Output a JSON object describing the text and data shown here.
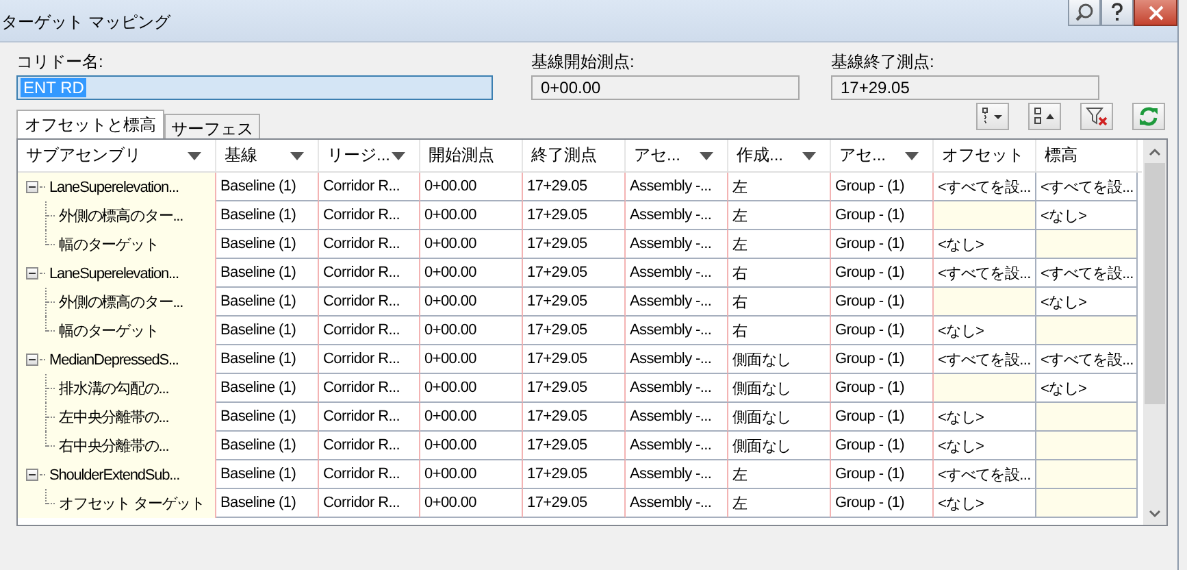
{
  "window": {
    "title": "ターゲット マッピング"
  },
  "fields": [
    {
      "label": "コリドー名:",
      "value": "ENT RD",
      "editable": true,
      "selected_text": true
    },
    {
      "label": "基線開始測点:",
      "value": "0+00.00",
      "editable": false,
      "selected_text": false
    },
    {
      "label": "基線終了測点:",
      "value": "17+29.05",
      "editable": false,
      "selected_text": false
    }
  ],
  "tabs": [
    {
      "label": "オフセットと標高",
      "selected": true
    },
    {
      "label": "サーフェス",
      "selected": false
    }
  ],
  "table": {
    "columns": [
      {
        "label": "サブアセンブリ",
        "menu": true
      },
      {
        "label": "基線",
        "menu": true
      },
      {
        "label": "リージ...",
        "menu": true
      },
      {
        "label": "開始測点",
        "menu": false
      },
      {
        "label": "終了測点",
        "menu": false
      },
      {
        "label": "アセ...",
        "menu": true
      },
      {
        "label": "作成...",
        "menu": true
      },
      {
        "label": "アセ...",
        "menu": true
      },
      {
        "label": "オフセット",
        "menu": false
      },
      {
        "label": "標高",
        "menu": false
      }
    ],
    "rows": [
      {
        "name": "LaneSuperelevation...",
        "baseline": "Baseline (1)",
        "region": "Corridor R...",
        "start": "0+00.00",
        "end": "17+29.05",
        "assembly": "Assembly -...",
        "side": "左",
        "group": "Group - (1)",
        "offset": "<すべてを設...",
        "elevation": "<すべてを設...",
        "expanded": true,
        "children": [
          {
            "name": "外側の標高のター...",
            "baseline": "Baseline (1)",
            "region": "Corridor R...",
            "start": "0+00.00",
            "end": "17+29.05",
            "assembly": "Assembly -...",
            "side": "左",
            "group": "Group - (1)",
            "elevation": "<なし>"
          },
          {
            "name": "幅のターゲット",
            "baseline": "Baseline (1)",
            "region": "Corridor R...",
            "start": "0+00.00",
            "end": "17+29.05",
            "assembly": "Assembly -...",
            "side": "左",
            "group": "Group - (1)",
            "offset": "<なし>"
          }
        ]
      },
      {
        "name": "LaneSuperelevation...",
        "baseline": "Baseline (1)",
        "region": "Corridor R...",
        "start": "0+00.00",
        "end": "17+29.05",
        "assembly": "Assembly -...",
        "side": "右",
        "group": "Group - (1)",
        "offset": "<すべてを設...",
        "elevation": "<すべてを設...",
        "expanded": true,
        "children": [
          {
            "name": "外側の標高のター...",
            "baseline": "Baseline (1)",
            "region": "Corridor R...",
            "start": "0+00.00",
            "end": "17+29.05",
            "assembly": "Assembly -...",
            "side": "右",
            "group": "Group - (1)",
            "elevation": "<なし>"
          },
          {
            "name": "幅のターゲット",
            "baseline": "Baseline (1)",
            "region": "Corridor R...",
            "start": "0+00.00",
            "end": "17+29.05",
            "assembly": "Assembly -...",
            "side": "右",
            "group": "Group - (1)",
            "offset": "<なし>"
          }
        ]
      },
      {
        "name": "MedianDepressedS...",
        "baseline": "Baseline (1)",
        "region": "Corridor R...",
        "start": "0+00.00",
        "end": "17+29.05",
        "assembly": "Assembly -...",
        "side": "側面なし",
        "group": "Group - (1)",
        "offset": "<すべてを設...",
        "elevation": "<すべてを設...",
        "expanded": true,
        "children": [
          {
            "name": "排水溝の勾配の...",
            "baseline": "Baseline (1)",
            "region": "Corridor R...",
            "start": "0+00.00",
            "end": "17+29.05",
            "assembly": "Assembly -...",
            "side": "側面なし",
            "group": "Group - (1)",
            "elevation": "<なし>"
          },
          {
            "name": "左中央分離帯の...",
            "baseline": "Baseline (1)",
            "region": "Corridor R...",
            "start": "0+00.00",
            "end": "17+29.05",
            "assembly": "Assembly -...",
            "side": "側面なし",
            "group": "Group - (1)",
            "offset": "<なし>"
          },
          {
            "name": "右中央分離帯の...",
            "baseline": "Baseline (1)",
            "region": "Corridor R...",
            "start": "0+00.00",
            "end": "17+29.05",
            "assembly": "Assembly -...",
            "side": "側面なし",
            "group": "Group - (1)",
            "offset": "<なし>"
          }
        ]
      },
      {
        "name": "ShoulderExtendSub...",
        "baseline": "Baseline (1)",
        "region": "Corridor R...",
        "start": "0+00.00",
        "end": "17+29.05",
        "assembly": "Assembly -...",
        "side": "左",
        "group": "Group - (1)",
        "offset": "<すべてを設...",
        "expanded": true,
        "children": [
          {
            "name": "オフセット ターゲット",
            "baseline": "Baseline (1)",
            "region": "Corridor R...",
            "start": "0+00.00",
            "end": "17+29.05",
            "assembly": "Assembly -...",
            "side": "左",
            "group": "Group - (1)",
            "offset": "<なし>"
          }
        ]
      }
    ]
  }
}
